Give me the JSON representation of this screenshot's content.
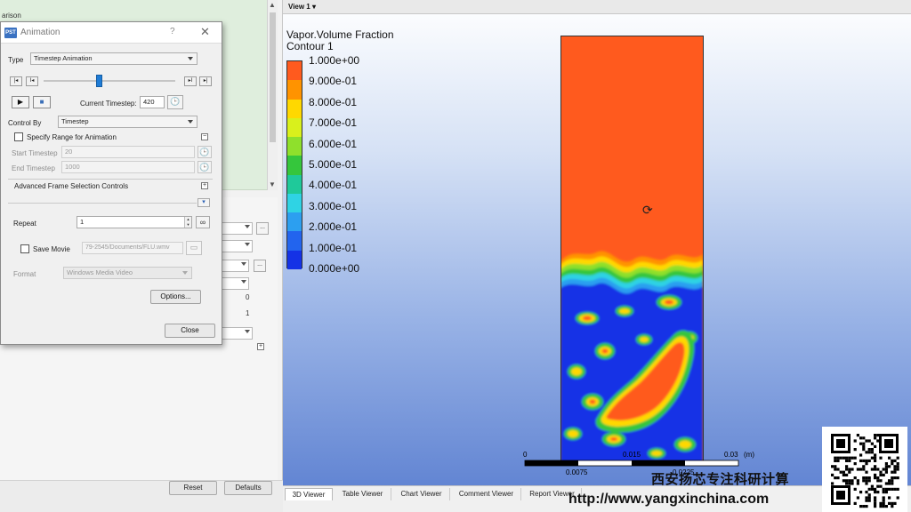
{
  "left_panel": {
    "tree_text": "arison",
    "detail_values": [
      "0",
      "1"
    ],
    "bottom_buttons": {
      "reset": "Reset",
      "defaults": "Defaults"
    }
  },
  "dialog": {
    "title": "Animation",
    "help": "?",
    "close": "✕",
    "type_label": "Type",
    "type_value": "Timestep Animation",
    "transport": {
      "first": "|◂",
      "prev": "I◂",
      "next": "▸I",
      "last": "▸|"
    },
    "play": "▶",
    "stop": "■",
    "current_timestep_label": "Current Timestep:",
    "current_timestep_value": "420",
    "timestep_position": 0.42,
    "control_by_label": "Control By",
    "control_by_value": "Timestep",
    "specify_range_label": "Specify Range for Animation",
    "start_timestep_label": "Start Timestep",
    "start_timestep_value": "20",
    "end_timestep_label": "End Timestep",
    "end_timestep_value": "1000",
    "advanced_label": "Advanced Frame Selection Controls",
    "repeat_label": "Repeat",
    "repeat_value": "1",
    "save_movie_label": "Save Movie",
    "save_movie_path": "79-2545/Documents/FLU.wmv",
    "format_label": "Format",
    "format_value": "Windows Media Video",
    "options_button": "Options...",
    "close_button": "Close"
  },
  "viewer": {
    "view_label": "View 1 ▾",
    "legend": {
      "title_line1": "Vapor.Volume Fraction",
      "title_line2": "Contour 1",
      "labels": [
        "1.000e+00",
        "9.000e-01",
        "8.000e-01",
        "7.000e-01",
        "6.000e-01",
        "5.000e-01",
        "4.000e-01",
        "3.000e-01",
        "2.000e-01",
        "1.000e-01",
        "0.000e+00"
      ],
      "colors": [
        "#ff5a1e",
        "#ff9300",
        "#ffd800",
        "#d9f01c",
        "#8fe02c",
        "#35c63c",
        "#1fc99a",
        "#2fd3e4",
        "#2c9ff0",
        "#2264ee",
        "#1432e6"
      ]
    },
    "scalebar": {
      "top_labels": [
        "0",
        "0.015",
        "0.03",
        "(m)"
      ],
      "bottom_labels": [
        "0.0075",
        "0.0225"
      ]
    },
    "tabs": [
      "3D Viewer",
      "Table Viewer",
      "Chart Viewer",
      "Comment Viewer",
      "Report Viewer"
    ]
  },
  "watermark": {
    "cn": "西安扬芯专注科研计算",
    "url": "http://www.yangxinchina.com"
  }
}
